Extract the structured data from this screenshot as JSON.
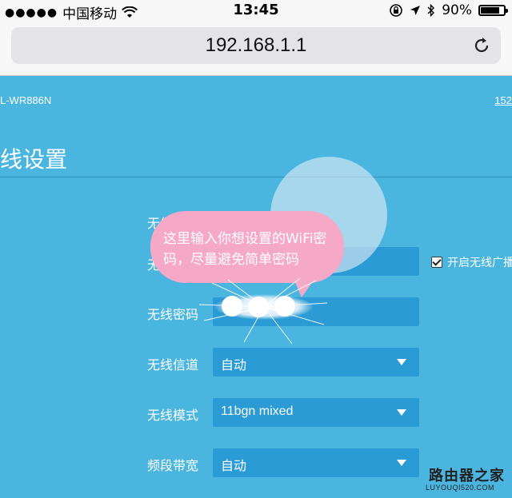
{
  "status_bar": {
    "carrier": "中国移动",
    "time": "13:45",
    "battery": "90%",
    "battery_level": 0.9
  },
  "browser": {
    "url": "192.168.1.1"
  },
  "router": {
    "model": "L-WR886N",
    "top_link": "152",
    "page_title": "线设置"
  },
  "form": {
    "ssid_label": "无线",
    "ssid_label_cut": "无",
    "password_label": "无线密码",
    "channel_label": "无线信道",
    "channel_value": "自动",
    "mode_label": "无线模式",
    "mode_value": "11bgn mixed",
    "bandwidth_label": "频段带宽",
    "bandwidth_value": "自动",
    "broadcast_label": "开启无线广播"
  },
  "annotation": {
    "bubble_text": "这里输入你想设置的WiFi密码，尽量避免简单密码"
  },
  "watermark": {
    "title": "路由器之家",
    "url": "LUYOUQI520.COM"
  }
}
